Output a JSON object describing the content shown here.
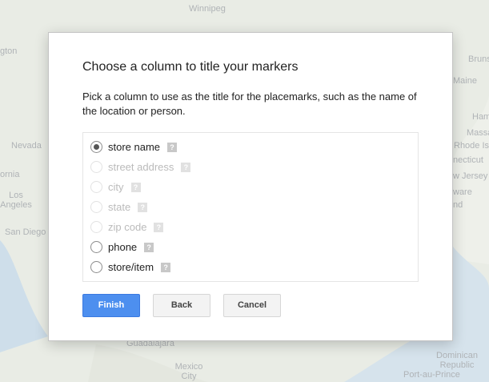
{
  "map": {
    "labels": [
      "Winnipeg",
      "gton",
      "Nevada",
      "ornia",
      "Los Angeles",
      "San Diego",
      "Bruns",
      "Maine",
      "Ham",
      "Massa",
      "Rhode Is",
      "necticut",
      "w Jersey",
      "ware",
      "nd",
      "Guadalajara",
      "Mexico City",
      "Dominican Republic",
      "Port-au-Prince"
    ]
  },
  "dialog": {
    "title": "Choose a column to title your markers",
    "description": "Pick a column to use as the title for the placemarks, such as the name of the location or person.",
    "help_glyph": "?",
    "options": [
      {
        "label": "store name",
        "selected": true,
        "disabled": false
      },
      {
        "label": "street address",
        "selected": false,
        "disabled": true
      },
      {
        "label": "city",
        "selected": false,
        "disabled": true
      },
      {
        "label": "state",
        "selected": false,
        "disabled": true
      },
      {
        "label": "zip code",
        "selected": false,
        "disabled": true
      },
      {
        "label": "phone",
        "selected": false,
        "disabled": false
      },
      {
        "label": "store/item",
        "selected": false,
        "disabled": false
      }
    ],
    "buttons": {
      "finish": "Finish",
      "back": "Back",
      "cancel": "Cancel"
    }
  },
  "colors": {
    "primary_button": "#4d8fef",
    "map_background": "#dfe4d9"
  }
}
